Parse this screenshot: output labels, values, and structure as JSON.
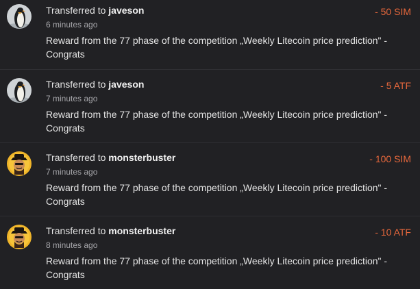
{
  "feed": {
    "items": [
      {
        "prefix": "Transferred to",
        "username": "javeson",
        "time": "6 minutes ago",
        "message": "Reward from the 77 phase of the competition „Weekly Litecoin price prediction\" - Congrats",
        "amount": "- 50 SIM",
        "avatar_icon": "penguin-avatar-icon"
      },
      {
        "prefix": "Transferred to",
        "username": "javeson",
        "time": "7 minutes ago",
        "message": "Reward from the 77 phase of the competition „Weekly Litecoin price prediction\" - Congrats",
        "amount": "- 5 ATF",
        "avatar_icon": "penguin-avatar-icon"
      },
      {
        "prefix": "Transferred to",
        "username": "monsterbuster",
        "time": "7 minutes ago",
        "message": "Reward from the 77 phase of the competition „Weekly Litecoin price prediction\" - Congrats",
        "amount": "- 100 SIM",
        "avatar_icon": "hat-character-avatar-icon"
      },
      {
        "prefix": "Transferred to",
        "username": "monsterbuster",
        "time": "8 minutes ago",
        "message": "Reward from the 77 phase of the competition „Weekly Litecoin price prediction\" - Congrats",
        "amount": "- 10 ATF",
        "avatar_icon": "hat-character-avatar-icon"
      }
    ]
  },
  "colors": {
    "background": "#212124",
    "amount": "#e8683c",
    "muted_text": "#a5a5a9",
    "divider": "#2f2f33"
  }
}
